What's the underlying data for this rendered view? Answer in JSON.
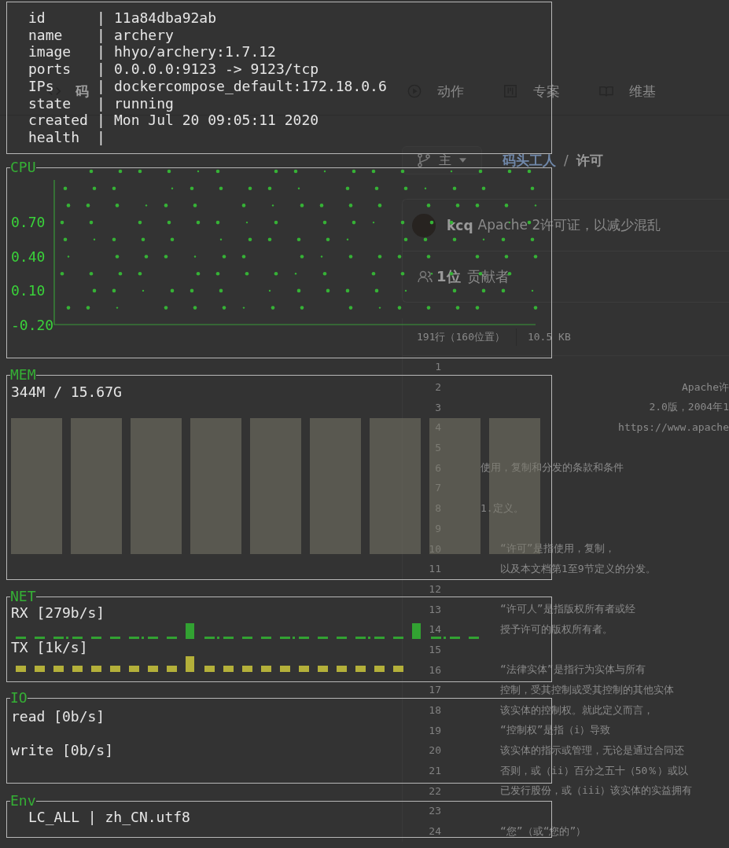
{
  "tabs": [
    {
      "label": "码",
      "kind": "code",
      "selected": true
    },
    {
      "label": "动作",
      "kind": "actions",
      "selected": false
    },
    {
      "label": "专案",
      "kind": "projects",
      "selected": false
    },
    {
      "label": "维基",
      "kind": "wiki",
      "selected": false
    }
  ],
  "branch": {
    "label": "主"
  },
  "breadcrumb": {
    "repo": "码头工人",
    "separator": "/",
    "file": "许可"
  },
  "commit": {
    "author": "kcq",
    "message": "Apache 2许可证，以减少混乱"
  },
  "contributors": {
    "count": "1位",
    "label": "贡献者"
  },
  "file_info": {
    "lines": "191行（160位置）",
    "size": "10.5 KB"
  },
  "code_lines": [
    {
      "number": "1",
      "kind": "blank"
    },
    {
      "number": "2",
      "kind": "title",
      "text": "Apache许"
    },
    {
      "number": "3",
      "kind": "title",
      "text": "2.0版，2004年1"
    },
    {
      "number": "4",
      "kind": "title",
      "text": "https://www.apache"
    },
    {
      "number": "5",
      "kind": "blank"
    },
    {
      "number": "6",
      "kind": "text",
      "text": "使用，复制和分发的条款和条件"
    },
    {
      "number": "7",
      "kind": "blank"
    },
    {
      "number": "8",
      "kind": "text",
      "text": "1.定义。"
    },
    {
      "number": "9",
      "kind": "blank"
    },
    {
      "number": "10",
      "kind": "indented",
      "text": "“许可”是指使用，复制，"
    },
    {
      "number": "11",
      "kind": "indented",
      "text": "以及本文档第1至9节定义的分发。"
    },
    {
      "number": "12",
      "kind": "blank"
    },
    {
      "number": "13",
      "kind": "indented",
      "text": "“许可人”是指版权所有者或经"
    },
    {
      "number": "14",
      "kind": "indented",
      "text": "授予许可的版权所有者。"
    },
    {
      "number": "15",
      "kind": "blank"
    },
    {
      "number": "16",
      "kind": "indented",
      "text": "“法律实体”是指行为实体与所有"
    },
    {
      "number": "17",
      "kind": "indented",
      "text": "控制，受其控制或受其控制的其他实体"
    },
    {
      "number": "18",
      "kind": "indented",
      "text": "该实体的控制权。就此定义而言，"
    },
    {
      "number": "19",
      "kind": "indented",
      "text": "“控制权”是指（i）导致"
    },
    {
      "number": "20",
      "kind": "indented",
      "text": "该实体的指示或管理，无论是通过合同还"
    },
    {
      "number": "21",
      "kind": "indented",
      "text": "否则，或（ii）百分之五十（50％）或以"
    },
    {
      "number": "22",
      "kind": "indented",
      "text": "已发行股份，或（iii）该实体的实益拥有"
    },
    {
      "number": "23",
      "kind": "blank"
    },
    {
      "number": "24",
      "kind": "indented",
      "text": "“您”（或“您的”）"
    }
  ],
  "container_info": [
    {
      "key": "id",
      "separator": "|",
      "value": "11a84dba92ab"
    },
    {
      "key": "name",
      "separator": "|",
      "value": "archery"
    },
    {
      "key": "image",
      "separator": "|",
      "value": "hhyo/archery:1.7.12"
    },
    {
      "key": "ports",
      "separator": "|",
      "value": "0.0.0.0:9123 -> 9123/tcp"
    },
    {
      "key": "IPs",
      "separator": "|",
      "value": "dockercompose_default:172.18.0.6"
    },
    {
      "key": "state",
      "separator": "|",
      "value": "running"
    },
    {
      "key": "created",
      "separator": "|",
      "value": "Mon Jul 20 09:05:11 2020"
    },
    {
      "key": "health",
      "separator": "|"
    }
  ],
  "cpu": {
    "title": "CPU",
    "y_ticks": [
      "0.70",
      "0.40",
      "0.10",
      "-0.20"
    ]
  },
  "mem": {
    "title": "MEM",
    "usage": "344M / 15.67G"
  },
  "net": {
    "title": "NET",
    "rx": "RX [279b/s]",
    "tx": "TX [1k/s]"
  },
  "io": {
    "title": "IO",
    "read": "read [0b/s]",
    "write": "write [0b/s]"
  },
  "env": {
    "title": "Env",
    "rows": [
      "LC_ALL | zh_CN.utf8"
    ]
  }
}
